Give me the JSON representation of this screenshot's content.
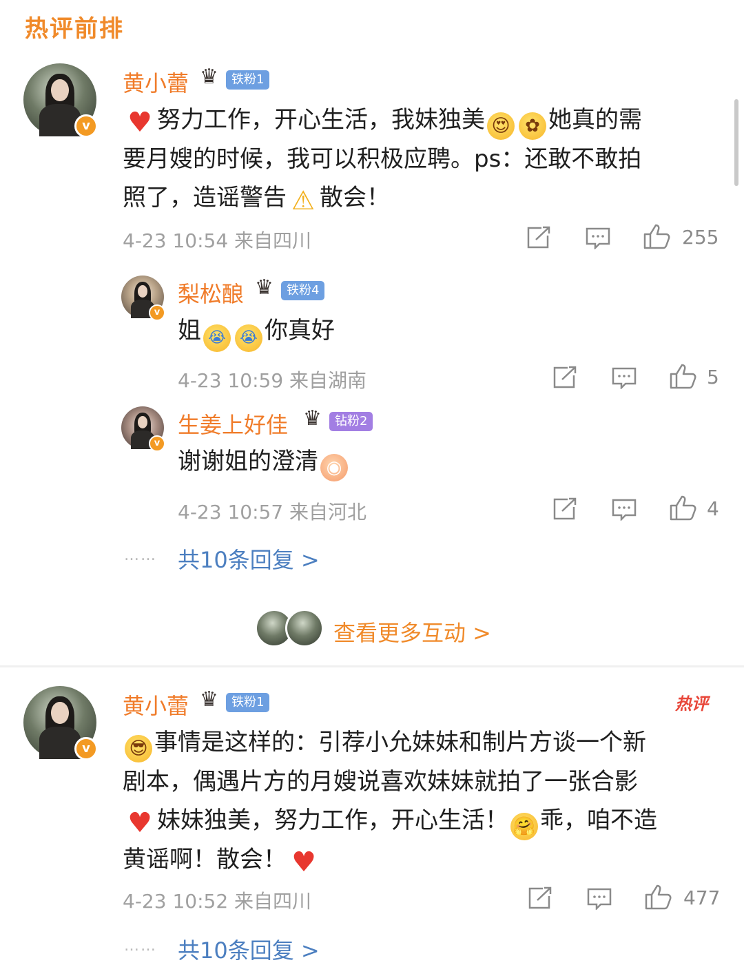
{
  "section": {
    "title": "热评前排"
  },
  "comments": [
    {
      "user": {
        "name": "黄小蕾",
        "fan_badge": "铁粉1"
      },
      "text_lines": [
        "努力工作，开心生活，我妹独美",
        "她真的需",
        "要月嫂的时候，我可以积极应聘。ps：还敢不敢拍",
        "照了，造谣警告",
        "散会！"
      ],
      "meta": "4-23 10:54  来自四川",
      "likes": "255",
      "replies": [
        {
          "user": {
            "name": "梨松酿",
            "fan_badge": "铁粉4"
          },
          "text_parts": [
            "姐",
            "你真好"
          ],
          "meta": "4-23 10:59  来自湖南",
          "likes": "5"
        },
        {
          "user": {
            "name": "生姜上好佳",
            "fan_badge": "钻粉2"
          },
          "text_parts": [
            "谢谢姐的澄清"
          ],
          "meta": "4-23 10:57  来自河北",
          "likes": "4"
        }
      ],
      "more_replies": "共10条回复 >"
    },
    {
      "user": {
        "name": "黄小蕾",
        "fan_badge": "铁粉1"
      },
      "hot_tag": "热评",
      "text_lines": [
        "事情是这样的：引荐小允妹妹和制片方谈一个新",
        "剧本，偶遇片方的月嫂说喜欢妹妹就拍了一张合影",
        "妹妹独美，努力工作，开心生活！",
        "乖，咱不造",
        "黄谣啊！散会！"
      ],
      "meta": "4-23 10:52  来自四川",
      "likes": "477",
      "more_replies": "共10条回复 >"
    }
  ],
  "interaction": {
    "label": "查看更多互动 >"
  },
  "dots": "……",
  "icons": [
    "crown-icon",
    "verified-icon",
    "share-icon",
    "comment-icon",
    "like-icon",
    "heart-emoji",
    "warning-emoji",
    "cry-emoji"
  ]
}
